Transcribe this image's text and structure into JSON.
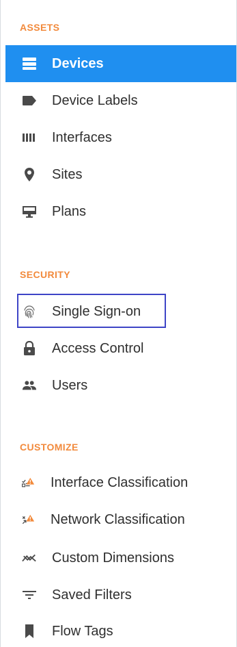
{
  "sections": {
    "assets": {
      "title": "ASSETS",
      "items": [
        {
          "label": "Devices",
          "icon": "devices-icon",
          "active": true
        },
        {
          "label": "Device Labels",
          "icon": "label-icon"
        },
        {
          "label": "Interfaces",
          "icon": "interfaces-icon"
        },
        {
          "label": "Sites",
          "icon": "location-pin-icon"
        },
        {
          "label": "Plans",
          "icon": "monitor-icon"
        }
      ]
    },
    "security": {
      "title": "SECURITY",
      "items": [
        {
          "label": "Single Sign-on",
          "icon": "fingerprint-icon",
          "highlighted": true
        },
        {
          "label": "Access Control",
          "icon": "lock-icon"
        },
        {
          "label": "Users",
          "icon": "users-icon"
        }
      ]
    },
    "customize": {
      "title": "CUSTOMIZE",
      "items": [
        {
          "label": "Interface Classification",
          "icon": "interface-classification-warning-icon"
        },
        {
          "label": "Network Classification",
          "icon": "network-classification-warning-icon"
        },
        {
          "label": "Custom Dimensions",
          "icon": "trend-icon"
        },
        {
          "label": "Saved Filters",
          "icon": "filter-lines-icon"
        },
        {
          "label": "Flow Tags",
          "icon": "bookmark-icon"
        }
      ]
    }
  },
  "colors": {
    "section_title": "#f28a3c",
    "active_background": "#1f8ff0",
    "active_text": "#ffffff",
    "item_text": "#2f2f2f",
    "icon": "#4a4a4a",
    "highlight_border": "#3d44c6",
    "warning": "#f28a3c"
  }
}
